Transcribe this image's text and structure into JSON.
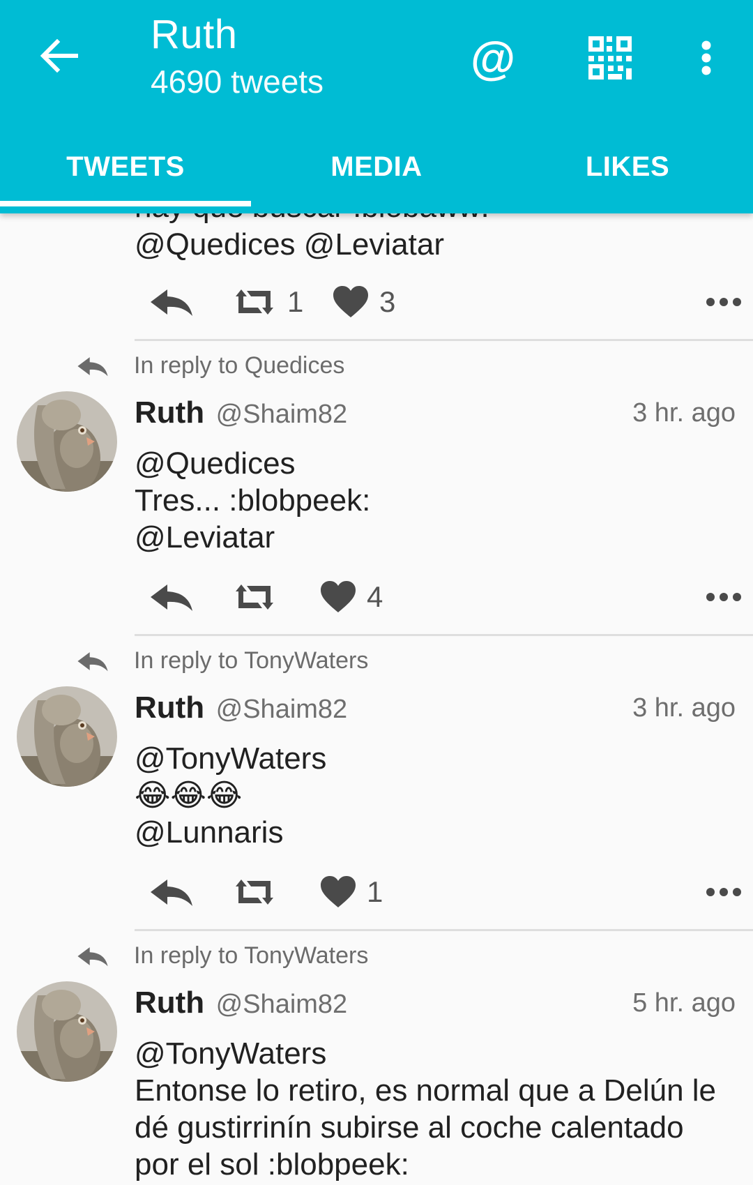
{
  "header": {
    "title": "Ruth",
    "subtitle": "4690 tweets",
    "at_icon": "at-icon",
    "qr_icon": "qr-code-icon",
    "more_icon": "more-vert-icon",
    "back_icon": "arrow-back-icon"
  },
  "tabs": [
    {
      "label": "TWEETS",
      "selected": true
    },
    {
      "label": "MEDIA",
      "selected": false
    },
    {
      "label": "LIKES",
      "selected": false
    }
  ],
  "colors": {
    "accent": "#00bcd4",
    "text": "#212121",
    "secondary": "#6e6e6e"
  },
  "partial_tweet": {
    "lines": [
      "hay que buscar :blobaww:",
      "@Quedices @Leviatar"
    ],
    "retweets": "1",
    "likes": "3"
  },
  "tweets": [
    {
      "reply_context": "In reply to Quedices",
      "name": "Ruth",
      "handle": "@Shaim82",
      "time": "3 hr. ago",
      "lines": [
        "@Quedices",
        "Tres... :blobpeek:",
        "@Leviatar"
      ],
      "retweets": "",
      "likes": "4"
    },
    {
      "reply_context": "In reply to TonyWaters",
      "name": "Ruth",
      "handle": "@Shaim82",
      "time": "3 hr. ago",
      "lines": [
        "@TonyWaters",
        "😂😂😂",
        "@Lunnaris"
      ],
      "retweets": "",
      "likes": "1"
    },
    {
      "reply_context": "In reply to TonyWaters",
      "name": "Ruth",
      "handle": "@Shaim82",
      "time": "5 hr. ago",
      "lines": [
        "@TonyWaters",
        "Entonse lo retiro, es normal que a Delún le",
        "dé gustirrinín subirse al coche calentado",
        "por el sol :blobpeek:"
      ]
    }
  ]
}
